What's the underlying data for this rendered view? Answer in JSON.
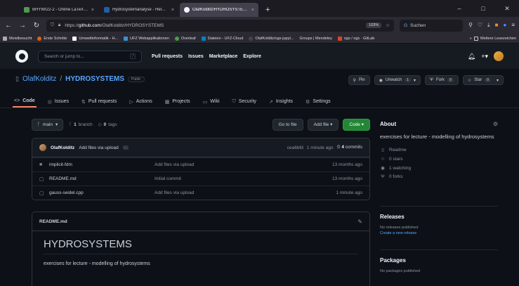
{
  "browser": {
    "tabs": [
      {
        "title": "BHYWI22-2 - Online LaTeX Edit",
        "color": "#4e9a4e",
        "active": false
      },
      {
        "title": "Hydrosystemanalyse - Helmholt",
        "color": "#1f5fa5",
        "active": false
      },
      {
        "title": "OlafKolditz/HYDROSYSTEMS",
        "color": "#f0f6fc",
        "active": true
      }
    ],
    "new_tab": "+",
    "url_prefix": "https://",
    "url_host": "github.com",
    "url_path": "/OlafKolditz/HYDROSYSTEMS",
    "zoom": "103%",
    "search_placeholder": "Suchen",
    "bookmarks": [
      {
        "label": "Meistbesucht",
        "color": "#aaaaaa"
      },
      {
        "label": "Erste Schritte",
        "color": "#e66000"
      },
      {
        "label": "Umweltinformatik - H...",
        "color": "#ffffff"
      },
      {
        "label": "UFZ Webapplikationen",
        "color": "#3e8ed0"
      },
      {
        "label": "Overleaf",
        "color": "#47a141"
      },
      {
        "label": "Dateien - UFZ-Cloud",
        "color": "#0082c9"
      },
      {
        "label": "OlafKolditz/ogs-jupyt...",
        "color": "#444444"
      },
      {
        "label": "Groups | Mendeley",
        "color": "#9f1d20"
      },
      {
        "label": "ogs / ogs · GitLab",
        "color": "#e24329"
      },
      {
        "label": "Weitere Lesezeichen",
        "color": "#cccccc"
      }
    ]
  },
  "github": {
    "search_placeholder": "Search or jump to...",
    "search_key": "/",
    "nav": [
      "Pull requests",
      "Issues",
      "Marketplace",
      "Explore"
    ]
  },
  "repo": {
    "owner": "OlafKolditz",
    "separator": "/",
    "name": "HYDROSYSTEMS",
    "visibility": "Public",
    "pin": "Pin",
    "unwatch": "Unwatch",
    "watch_count": "1",
    "fork": "Fork",
    "fork_count": "0",
    "star": "Star",
    "star_count": "0",
    "tabs": [
      {
        "label": "Code",
        "icon": "<>",
        "active": true
      },
      {
        "label": "Issues",
        "icon": "◎",
        "active": false
      },
      {
        "label": "Pull requests",
        "icon": "⇅",
        "active": false
      },
      {
        "label": "Actions",
        "icon": "▷",
        "active": false
      },
      {
        "label": "Projects",
        "icon": "▦",
        "active": false
      },
      {
        "label": "Wiki",
        "icon": "▭",
        "active": false
      },
      {
        "label": "Security",
        "icon": "⛉",
        "active": false
      },
      {
        "label": "Insights",
        "icon": "↗",
        "active": false
      },
      {
        "label": "Settings",
        "icon": "⚙",
        "active": false
      }
    ]
  },
  "toolbar": {
    "branch": "main",
    "branch_count": "1",
    "branch_label": "branch",
    "tag_count": "0",
    "tag_label": "tags",
    "go_to_file": "Go to file",
    "add_file": "Add file",
    "code": "Code"
  },
  "commit": {
    "author": "OlafKolditz",
    "message": "Add files via upload",
    "more": "...",
    "hash": "cea6bfd",
    "time": "1 minute ago",
    "count": "4",
    "count_label": "commits"
  },
  "files": [
    {
      "name": "implicit-fdm",
      "type": "dir",
      "message": "Add files via upload",
      "time": "13 months ago"
    },
    {
      "name": "README.md",
      "type": "file",
      "message": "Initial commit",
      "time": "13 months ago"
    },
    {
      "name": "gauss-seidel.cpp",
      "type": "file",
      "message": "Add files via upload",
      "time": "1 minute ago"
    }
  ],
  "readme": {
    "filename": "README.md",
    "title": "HYDROSYSTEMS",
    "text": "exercises for lecture - modelling of hydrosystems"
  },
  "about": {
    "title": "About",
    "description": "exercises for lecture - modelling of hydrosystems",
    "items": [
      {
        "icon": "▯",
        "name": "readme",
        "label": "Readme"
      },
      {
        "icon": "☆",
        "name": "star",
        "label": "0 stars"
      },
      {
        "icon": "◉",
        "name": "eye",
        "label": "1 watching"
      },
      {
        "icon": "Ψ",
        "name": "fork",
        "label": "0 forks"
      }
    ]
  },
  "releases": {
    "title": "Releases",
    "empty": "No releases published",
    "create": "Create a new release"
  },
  "packages": {
    "title": "Packages",
    "empty": "No packages published"
  }
}
